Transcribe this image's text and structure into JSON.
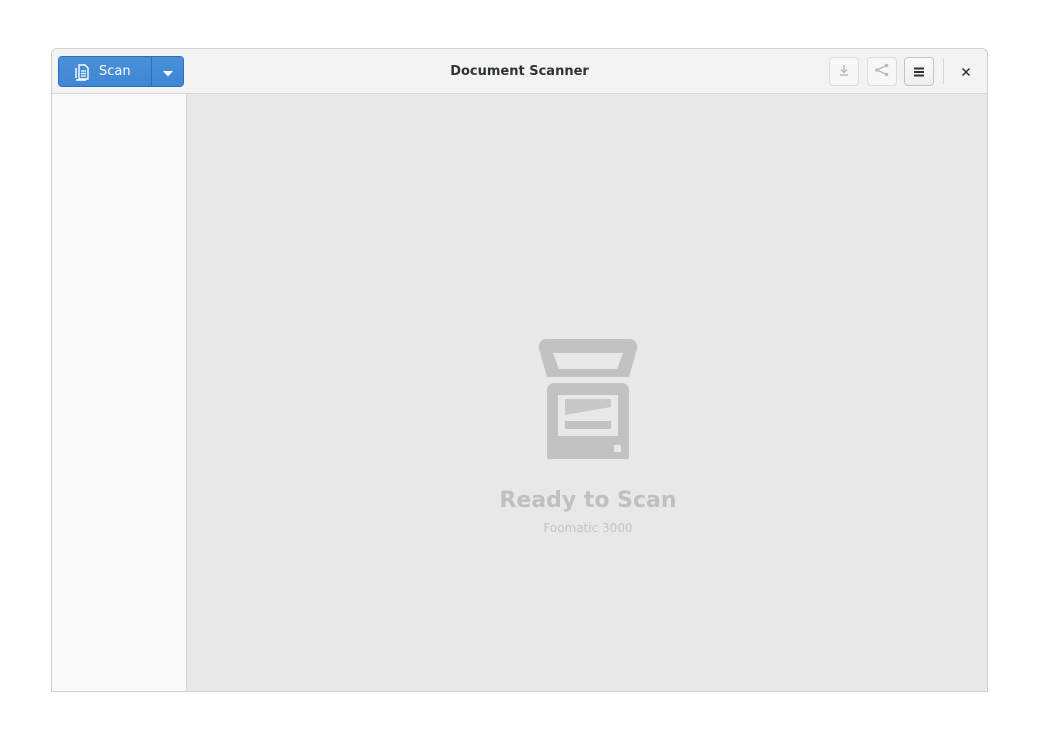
{
  "window": {
    "title": "Document Scanner"
  },
  "headerbar": {
    "scan_label": "Scan",
    "scan_icon": "document-scan-icon",
    "dropdown_icon": "chevron-down-icon",
    "save_icon": "download-icon",
    "share_icon": "share-icon",
    "menu_icon": "hamburger-menu-icon",
    "close_icon": "close-icon"
  },
  "status": {
    "title": "Ready to Scan",
    "subtitle": "Foomatic 3000",
    "icon": "scanner-icon"
  },
  "colors": {
    "accent": "#4a90d9",
    "status_text": "#c0c0c0",
    "content_bg": "#e8e8e8",
    "sidebar_bg": "#fafafa"
  }
}
